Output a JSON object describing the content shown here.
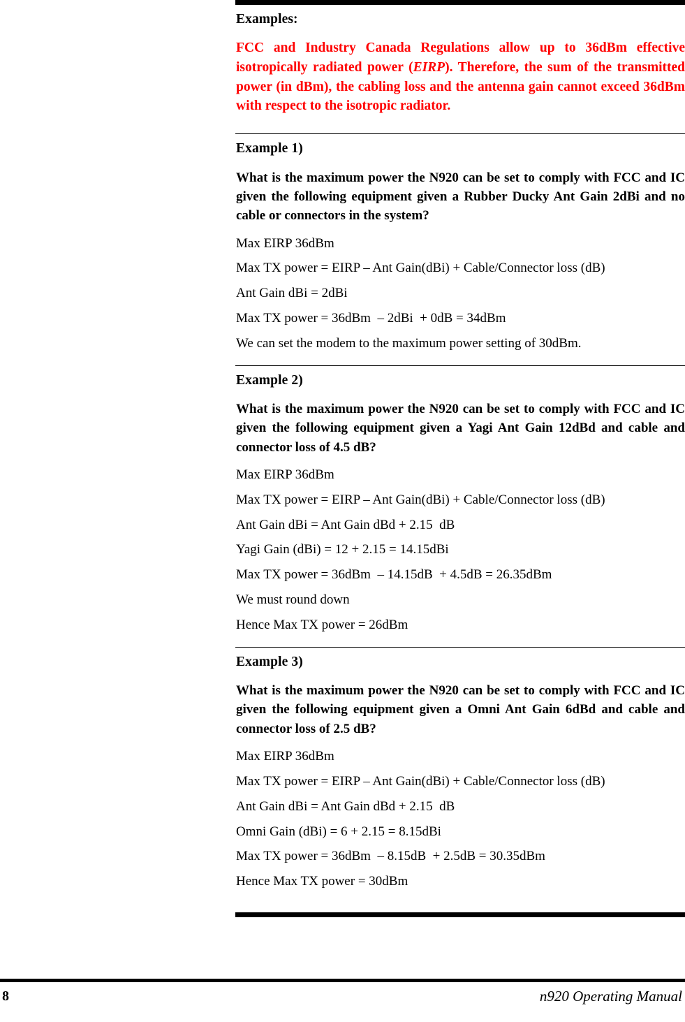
{
  "document": {
    "examples_heading": "Examples:",
    "notice": {
      "part1": "FCC and Industry Canada Regulations allow up to 36dBm effective isotropically radiated power (",
      "emphasis": "EIRP",
      "part2": ").  Therefore, the sum of the transmitted power (in dBm), the cabling loss and the antenna gain cannot exceed 36dBm with respect to the isotropic radiator.",
      "color": "#FF0000"
    },
    "sections": [
      {
        "heading": "Example 1)",
        "question": "What is the maximum power the N920 can be set to comply with FCC and IC given the following equipment given a Rubber Ducky Ant Gain 2dBi and no cable or connectors in the system?",
        "lines": [
          "Max EIRP 36dBm",
          "Max TX power = EIRP – Ant Gain(dBi) + Cable/Connector loss (dB)",
          "Ant Gain dBi = 2dBi",
          "Max TX power = 36dBm  – 2dBi  + 0dB = 34dBm",
          "We can set the modem to the maximum power setting of 30dBm."
        ]
      },
      {
        "heading": "Example 2)",
        "question": "What is the maximum power the N920 can be set to comply with FCC and IC given the following equipment given a Yagi Ant Gain 12dBd and cable and connector loss of 4.5 dB?",
        "lines": [
          "Max EIRP 36dBm",
          "Max TX power = EIRP – Ant Gain(dBi) + Cable/Connector loss (dB)",
          "Ant Gain dBi = Ant Gain dBd + 2.15  dB",
          "Yagi Gain (dBi) = 12 + 2.15 = 14.15dBi",
          "Max TX power = 36dBm  – 14.15dB  + 4.5dB = 26.35dBm",
          "We must round down",
          "Hence Max TX power = 26dBm"
        ]
      },
      {
        "heading": "Example 3)",
        "question": "What is the maximum power the N920 can be set to comply with FCC and IC given the following equipment given a Omni Ant Gain 6dBd and cable and connector loss of 2.5 dB?",
        "lines": [
          "Max EIRP 36dBm",
          "Max TX power = EIRP – Ant Gain(dBi) + Cable/Connector loss (dB)",
          "Ant Gain dBi = Ant Gain dBd + 2.15  dB",
          "Omni Gain (dBi) = 6 + 2.15 = 8.15dBi",
          "Max TX power = 36dBm  – 8.15dB  + 2.5dB = 30.35dBm",
          "Hence Max TX power = 30dBm"
        ]
      }
    ]
  },
  "footer": {
    "page_number": "8",
    "manual_title": "n920 Operating Manual"
  }
}
